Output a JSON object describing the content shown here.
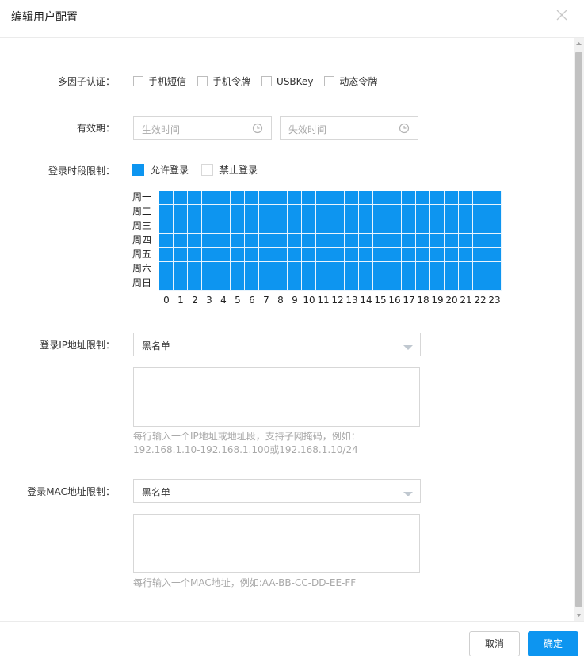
{
  "dialog": {
    "title": "编辑用户配置"
  },
  "mfa": {
    "label": "多因子认证：",
    "options": [
      "手机短信",
      "手机令牌",
      "USBKey",
      "动态令牌"
    ]
  },
  "validity": {
    "label": "有效期：",
    "start_placeholder": "生效时间",
    "end_placeholder": "失效时间"
  },
  "login_time": {
    "label": "登录时段限制：",
    "legend_allow": "允许登录",
    "legend_deny": "禁止登录",
    "days": [
      "周一",
      "周二",
      "周三",
      "周四",
      "周五",
      "周六",
      "周日"
    ],
    "hours": [
      "0",
      "1",
      "2",
      "3",
      "4",
      "5",
      "6",
      "7",
      "8",
      "9",
      "10",
      "11",
      "12",
      "13",
      "14",
      "15",
      "16",
      "17",
      "18",
      "19",
      "20",
      "21",
      "22",
      "23"
    ],
    "allowed_color": "#0d95f0"
  },
  "ip_limit": {
    "label": "登录IP地址限制：",
    "mode": "黑名单",
    "hint_line1": "每行输入一个IP地址或地址段，支持子网掩码，例如：",
    "hint_line2": "192.168.1.10-192.168.1.100或192.168.1.10/24"
  },
  "mac_limit": {
    "label": "登录MAC地址限制：",
    "mode": "黑名单",
    "hint": "每行输入一个MAC地址，例如:AA-BB-CC-DD-EE-FF"
  },
  "footer": {
    "cancel_label": "取消",
    "ok_label": "确定"
  },
  "colors": {
    "primary": "#0d95f0"
  }
}
